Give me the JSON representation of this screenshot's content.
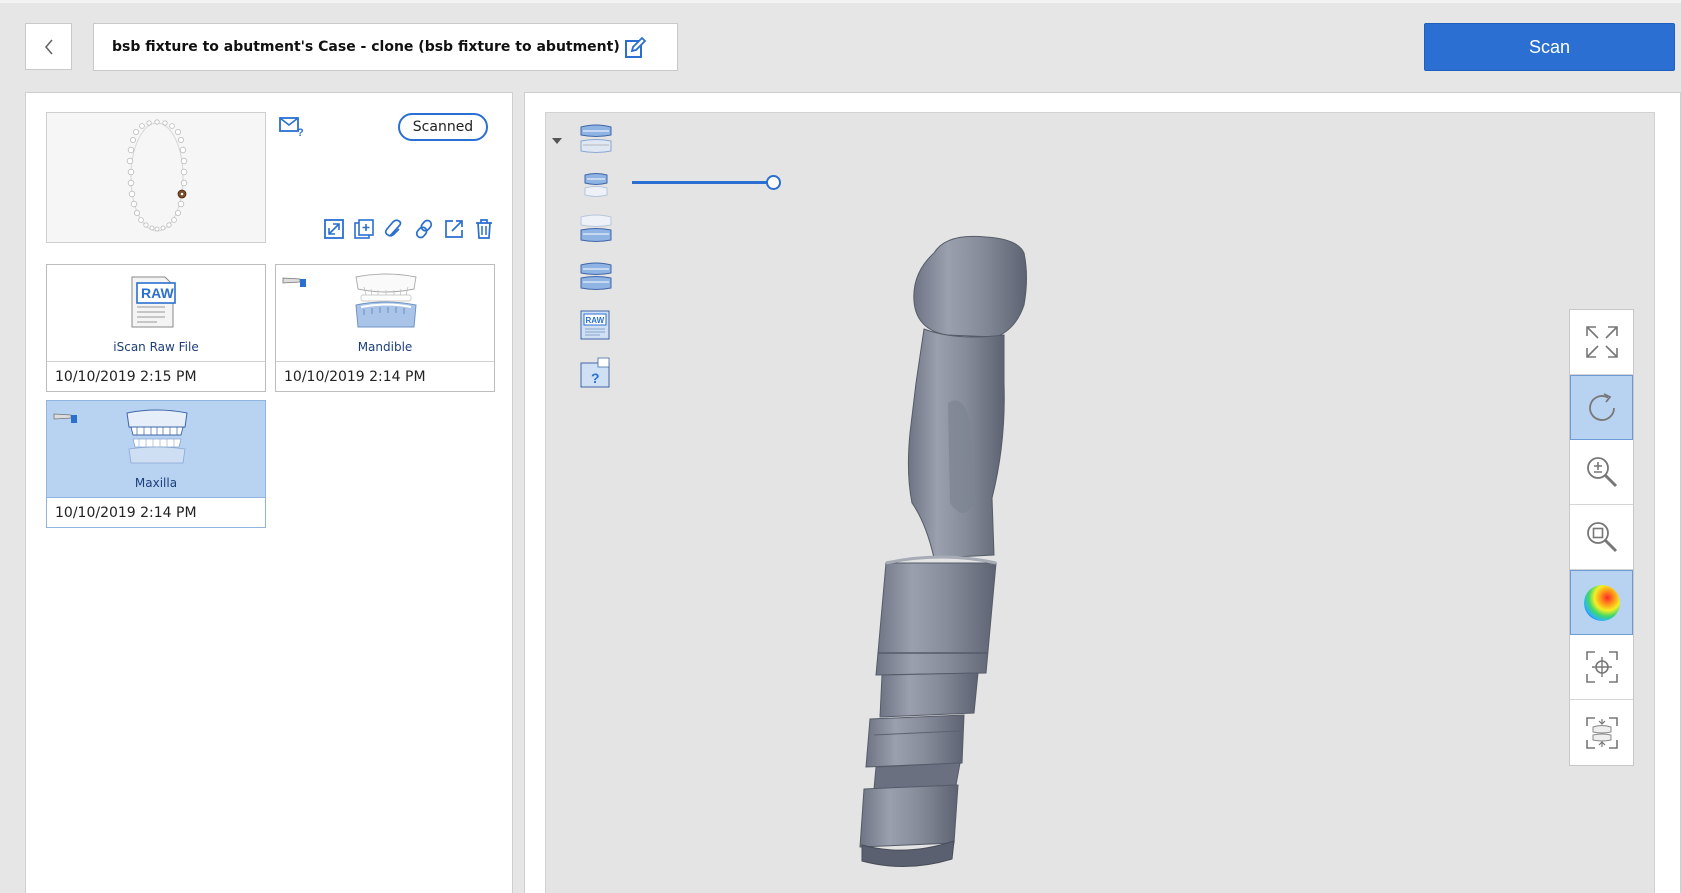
{
  "header": {
    "back_icon": "chevron-left-icon",
    "title": "bsb fixture to abutment's Case - clone (bsb fixture to abutment)",
    "edit_icon": "edit-icon",
    "scan_label": "Scan"
  },
  "case_panel": {
    "status": "Scanned",
    "mail_icon": "mail-question-icon",
    "toolbar_icons": [
      "expand-icon",
      "add-copy-icon",
      "attach-icon",
      "link-icon",
      "export-icon",
      "trash-icon"
    ],
    "files": [
      {
        "label": "iScan Raw File",
        "date": "10/10/2019 2:15 PM",
        "icon": "raw-file-icon",
        "selected": false
      },
      {
        "label": "Mandible",
        "date": "10/10/2019 2:14 PM",
        "icon": "mandible-icon",
        "selected": false
      },
      {
        "label": "Maxilla",
        "date": "10/10/2019 2:14 PM",
        "icon": "maxilla-icon",
        "selected": true
      }
    ]
  },
  "viewer": {
    "layers": [
      "both-arches-icon",
      "maxilla-layer-icon",
      "mandible-layer-icon",
      "bite-layer-icon",
      "raw-layer-icon",
      "unknown-layer-icon"
    ],
    "opacity_slider": 1.0,
    "view_tools": [
      {
        "icon": "fit-view-icon",
        "active": false
      },
      {
        "icon": "rotate-icon",
        "active": true
      },
      {
        "icon": "zoom-in-out-icon",
        "active": false
      },
      {
        "icon": "zoom-window-icon",
        "active": false
      },
      {
        "icon": "color-map-icon",
        "active": true
      },
      {
        "icon": "center-target-icon",
        "active": false
      },
      {
        "icon": "occlusal-view-icon",
        "active": false
      }
    ],
    "accent_color": "#2a6fd1",
    "selected_color": "#b8d3f1"
  }
}
